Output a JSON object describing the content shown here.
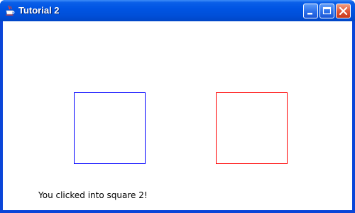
{
  "window": {
    "title": "Tutorial 2",
    "app_icon": "java-coffee-cup-icon",
    "controls": {
      "minimize_icon": "minimize-icon",
      "maximize_icon": "maximize-icon",
      "close_icon": "close-icon"
    }
  },
  "canvas": {
    "squares": [
      {
        "id": 1,
        "border_color": "#0000ff"
      },
      {
        "id": 2,
        "border_color": "#ff0000"
      }
    ],
    "status": "You clicked into square 2!"
  },
  "colors": {
    "titlebar": "#0054e3",
    "close_button": "#e0583a",
    "client_background": "#ffffff"
  }
}
